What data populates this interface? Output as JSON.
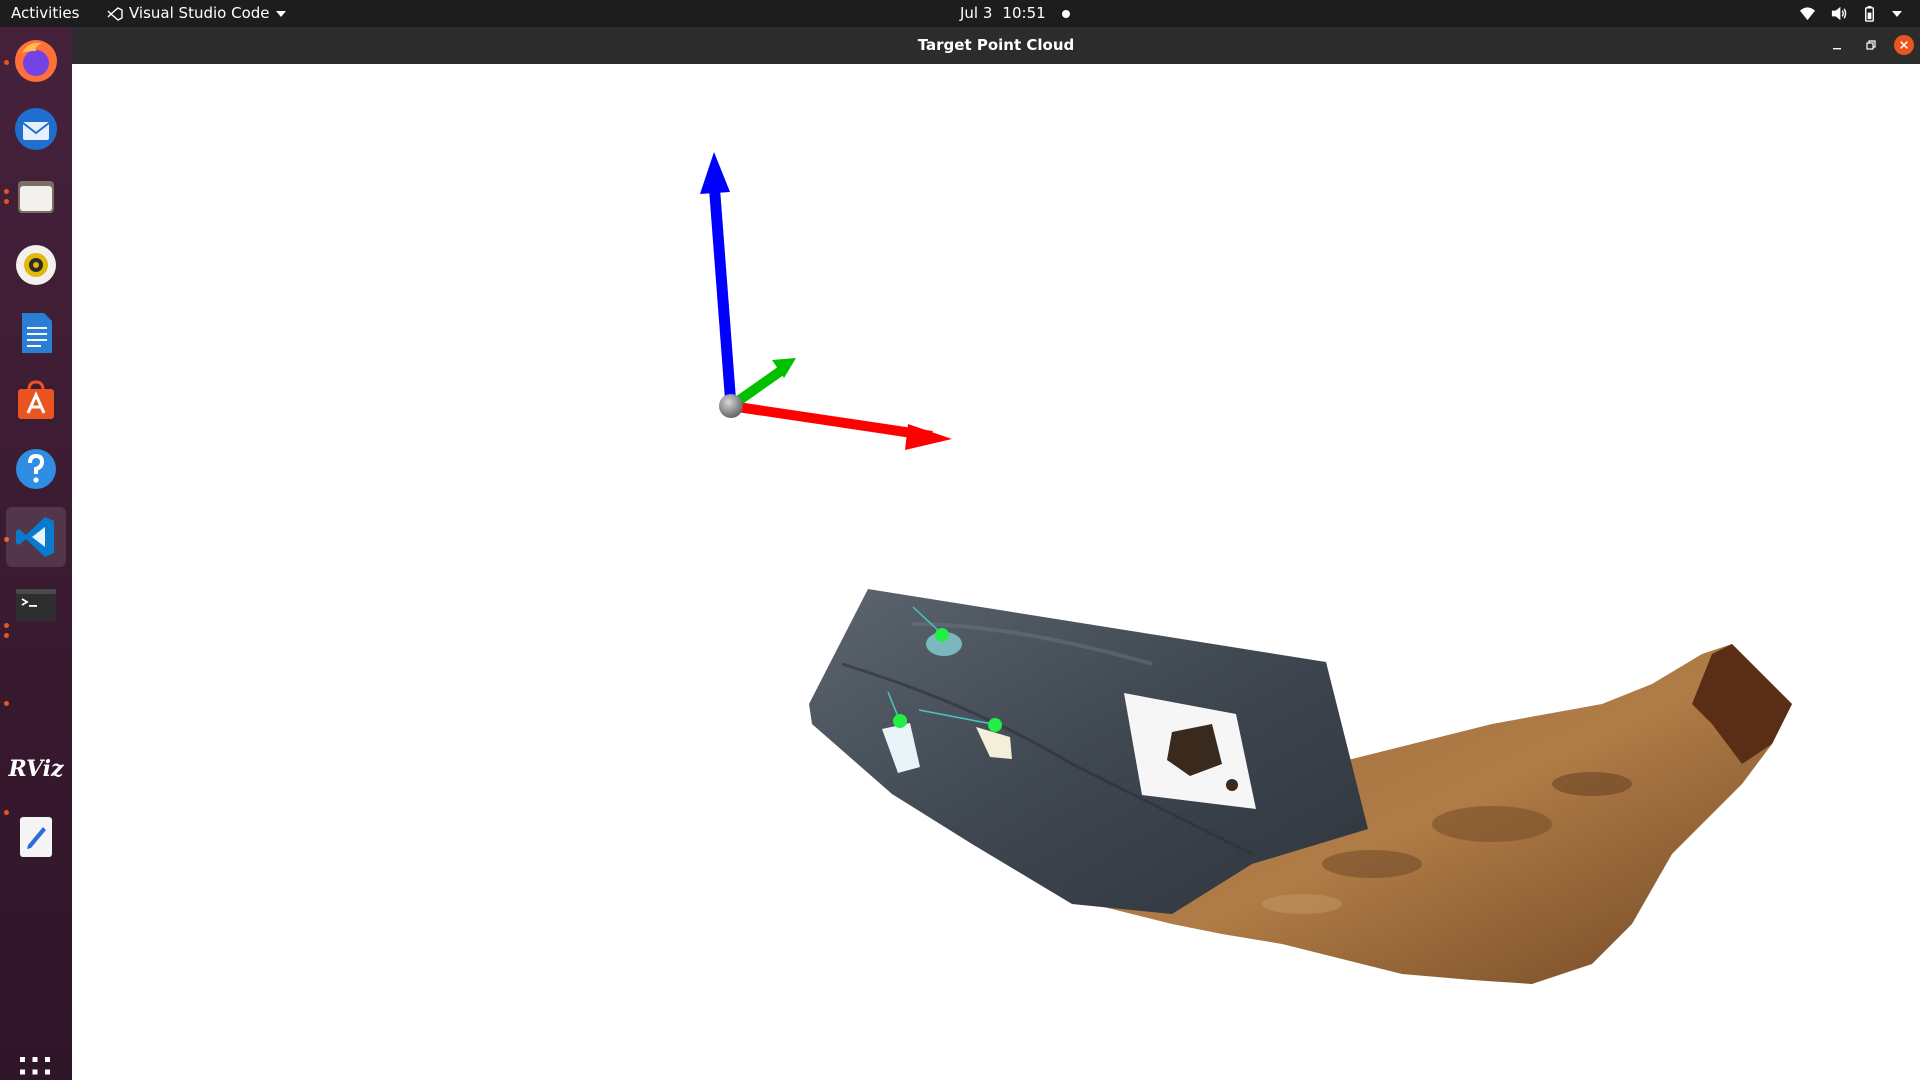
{
  "topbar": {
    "activities_label": "Activities",
    "app_menu_label": "Visual Studio Code",
    "date": "Jul 3",
    "time": "10:51"
  },
  "dock": {
    "items": [
      {
        "name": "firefox",
        "running": true,
        "active": false
      },
      {
        "name": "thunderbird",
        "running": false,
        "active": false
      },
      {
        "name": "files",
        "running": true,
        "active": false
      },
      {
        "name": "rhythmbox",
        "running": false,
        "active": false
      },
      {
        "name": "libreoffice-writer",
        "running": false,
        "active": false
      },
      {
        "name": "ubuntu-software",
        "running": false,
        "active": false
      },
      {
        "name": "help",
        "running": false,
        "active": false
      },
      {
        "name": "visual-studio-code",
        "running": true,
        "active": true
      },
      {
        "name": "terminal",
        "running": true,
        "active": false
      },
      {
        "name": "rviz",
        "running": true,
        "active": false
      },
      {
        "name": "text-editor",
        "running": true,
        "active": false
      }
    ],
    "rviz_label": "RViz",
    "accent_color": "#e95420"
  },
  "window": {
    "title": "Target Point Cloud"
  },
  "scene": {
    "axes_colors": {
      "x": "#ff0000",
      "y": "#00c000",
      "z": "#0000ff"
    }
  }
}
